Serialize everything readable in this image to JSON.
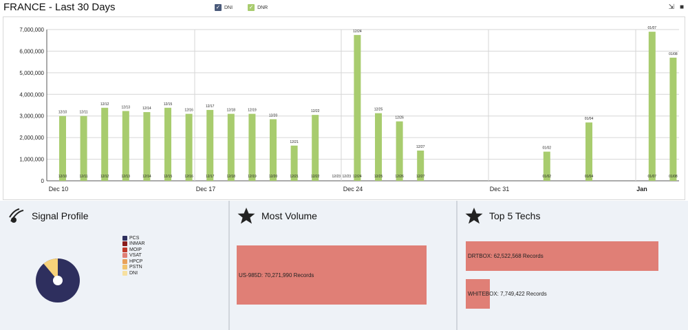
{
  "header": {
    "title": "FRANCE - Last 30 Days",
    "legend": [
      {
        "label": "DNI",
        "color": "#4a5a7a",
        "checked": true
      },
      {
        "label": "DNR",
        "color": "#a8cc6e",
        "checked": true
      }
    ],
    "tools": [
      {
        "icon": "export-icon"
      },
      {
        "icon": "stop-icon"
      }
    ]
  },
  "chart_data": {
    "type": "bar",
    "ylim": [
      0,
      7000000
    ],
    "yticks": [
      "0",
      "1,000,000",
      "2,000,000",
      "3,000,000",
      "4,000,000",
      "5,000,000",
      "6,000,000",
      "7,000,000"
    ],
    "xticks": [
      "Dec 10",
      "Dec 17",
      "Dec 24",
      "Dec 31",
      "Jan"
    ],
    "grid": true,
    "series": [
      {
        "name": "DNR",
        "color": "#a8cc6e",
        "points": [
          {
            "date": "12/10",
            "value": 3000000
          },
          {
            "date": "12/11",
            "value": 3000000
          },
          {
            "date": "12/12",
            "value": 3380000
          },
          {
            "date": "12/13",
            "value": 3230000
          },
          {
            "date": "12/14",
            "value": 3180000
          },
          {
            "date": "12/15",
            "value": 3380000
          },
          {
            "date": "12/16",
            "value": 3100000
          },
          {
            "date": "12/17",
            "value": 3280000
          },
          {
            "date": "12/18",
            "value": 3100000
          },
          {
            "date": "12/19",
            "value": 3100000
          },
          {
            "date": "12/20",
            "value": 2850000
          },
          {
            "date": "12/21",
            "value": 1630000
          },
          {
            "date": "12/22",
            "value": 3050000
          },
          {
            "date": "12/23",
            "value": 0
          },
          {
            "date": "12/23",
            "value": 0
          },
          {
            "date": "12/24",
            "value": 6750000
          },
          {
            "date": "12/25",
            "value": 3130000
          },
          {
            "date": "12/26",
            "value": 2750000
          },
          {
            "date": "12/27",
            "value": 1400000
          },
          {
            "date": "01/02",
            "value": 1350000
          },
          {
            "date": "01/04",
            "value": 2700000
          },
          {
            "date": "01/07",
            "value": 6900000
          },
          {
            "date": "01/08",
            "value": 5700000
          }
        ]
      }
    ]
  },
  "signal_profile": {
    "title": "Signal Profile",
    "legend": [
      {
        "label": "PCS",
        "color": "#2e2f5e"
      },
      {
        "label": "INMAR",
        "color": "#8a1c1c"
      },
      {
        "label": "MOIP",
        "color": "#c0392b"
      },
      {
        "label": "VSAT",
        "color": "#e07f76"
      },
      {
        "label": "HPCP",
        "color": "#e8a15a"
      },
      {
        "label": "PSTN",
        "color": "#f2c46e"
      },
      {
        "label": "DNI",
        "color": "#f7e0a0"
      }
    ],
    "pie": [
      {
        "label": "PCS",
        "value": 0.9,
        "color": "#2e2f5e"
      },
      {
        "label": "PSTN",
        "value": 0.1,
        "color": "#f7d27a"
      }
    ]
  },
  "most_volume": {
    "title": "Most Volume",
    "bars": [
      {
        "label": "US-985D: 70,271,990 Records",
        "value": 70271990
      }
    ]
  },
  "top_techs": {
    "title": "Top 5 Techs",
    "bars": [
      {
        "label": "DRTBOX: 62,522,568 Records",
        "value": 62522568
      },
      {
        "label": "WHITEBOX: 7,749,422 Records",
        "value": 7749422
      }
    ]
  }
}
